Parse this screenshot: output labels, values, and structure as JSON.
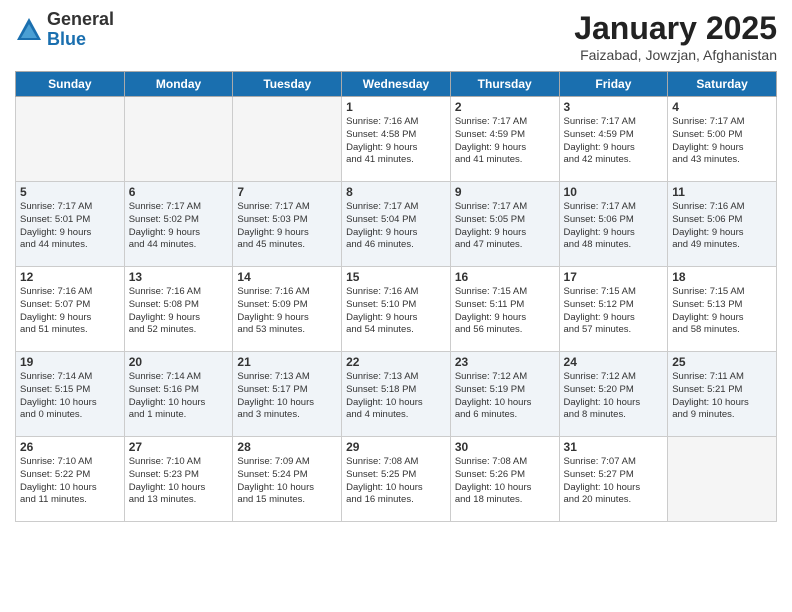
{
  "logo": {
    "general": "General",
    "blue": "Blue"
  },
  "header": {
    "title": "January 2025",
    "subtitle": "Faizabad, Jowzjan, Afghanistan"
  },
  "days_of_week": [
    "Sunday",
    "Monday",
    "Tuesday",
    "Wednesday",
    "Thursday",
    "Friday",
    "Saturday"
  ],
  "weeks": [
    [
      {
        "day": "",
        "info": ""
      },
      {
        "day": "",
        "info": ""
      },
      {
        "day": "",
        "info": ""
      },
      {
        "day": "1",
        "info": "Sunrise: 7:16 AM\nSunset: 4:58 PM\nDaylight: 9 hours\nand 41 minutes."
      },
      {
        "day": "2",
        "info": "Sunrise: 7:17 AM\nSunset: 4:59 PM\nDaylight: 9 hours\nand 41 minutes."
      },
      {
        "day": "3",
        "info": "Sunrise: 7:17 AM\nSunset: 4:59 PM\nDaylight: 9 hours\nand 42 minutes."
      },
      {
        "day": "4",
        "info": "Sunrise: 7:17 AM\nSunset: 5:00 PM\nDaylight: 9 hours\nand 43 minutes."
      }
    ],
    [
      {
        "day": "5",
        "info": "Sunrise: 7:17 AM\nSunset: 5:01 PM\nDaylight: 9 hours\nand 44 minutes."
      },
      {
        "day": "6",
        "info": "Sunrise: 7:17 AM\nSunset: 5:02 PM\nDaylight: 9 hours\nand 44 minutes."
      },
      {
        "day": "7",
        "info": "Sunrise: 7:17 AM\nSunset: 5:03 PM\nDaylight: 9 hours\nand 45 minutes."
      },
      {
        "day": "8",
        "info": "Sunrise: 7:17 AM\nSunset: 5:04 PM\nDaylight: 9 hours\nand 46 minutes."
      },
      {
        "day": "9",
        "info": "Sunrise: 7:17 AM\nSunset: 5:05 PM\nDaylight: 9 hours\nand 47 minutes."
      },
      {
        "day": "10",
        "info": "Sunrise: 7:17 AM\nSunset: 5:06 PM\nDaylight: 9 hours\nand 48 minutes."
      },
      {
        "day": "11",
        "info": "Sunrise: 7:16 AM\nSunset: 5:06 PM\nDaylight: 9 hours\nand 49 minutes."
      }
    ],
    [
      {
        "day": "12",
        "info": "Sunrise: 7:16 AM\nSunset: 5:07 PM\nDaylight: 9 hours\nand 51 minutes."
      },
      {
        "day": "13",
        "info": "Sunrise: 7:16 AM\nSunset: 5:08 PM\nDaylight: 9 hours\nand 52 minutes."
      },
      {
        "day": "14",
        "info": "Sunrise: 7:16 AM\nSunset: 5:09 PM\nDaylight: 9 hours\nand 53 minutes."
      },
      {
        "day": "15",
        "info": "Sunrise: 7:16 AM\nSunset: 5:10 PM\nDaylight: 9 hours\nand 54 minutes."
      },
      {
        "day": "16",
        "info": "Sunrise: 7:15 AM\nSunset: 5:11 PM\nDaylight: 9 hours\nand 56 minutes."
      },
      {
        "day": "17",
        "info": "Sunrise: 7:15 AM\nSunset: 5:12 PM\nDaylight: 9 hours\nand 57 minutes."
      },
      {
        "day": "18",
        "info": "Sunrise: 7:15 AM\nSunset: 5:13 PM\nDaylight: 9 hours\nand 58 minutes."
      }
    ],
    [
      {
        "day": "19",
        "info": "Sunrise: 7:14 AM\nSunset: 5:15 PM\nDaylight: 10 hours\nand 0 minutes."
      },
      {
        "day": "20",
        "info": "Sunrise: 7:14 AM\nSunset: 5:16 PM\nDaylight: 10 hours\nand 1 minute."
      },
      {
        "day": "21",
        "info": "Sunrise: 7:13 AM\nSunset: 5:17 PM\nDaylight: 10 hours\nand 3 minutes."
      },
      {
        "day": "22",
        "info": "Sunrise: 7:13 AM\nSunset: 5:18 PM\nDaylight: 10 hours\nand 4 minutes."
      },
      {
        "day": "23",
        "info": "Sunrise: 7:12 AM\nSunset: 5:19 PM\nDaylight: 10 hours\nand 6 minutes."
      },
      {
        "day": "24",
        "info": "Sunrise: 7:12 AM\nSunset: 5:20 PM\nDaylight: 10 hours\nand 8 minutes."
      },
      {
        "day": "25",
        "info": "Sunrise: 7:11 AM\nSunset: 5:21 PM\nDaylight: 10 hours\nand 9 minutes."
      }
    ],
    [
      {
        "day": "26",
        "info": "Sunrise: 7:10 AM\nSunset: 5:22 PM\nDaylight: 10 hours\nand 11 minutes."
      },
      {
        "day": "27",
        "info": "Sunrise: 7:10 AM\nSunset: 5:23 PM\nDaylight: 10 hours\nand 13 minutes."
      },
      {
        "day": "28",
        "info": "Sunrise: 7:09 AM\nSunset: 5:24 PM\nDaylight: 10 hours\nand 15 minutes."
      },
      {
        "day": "29",
        "info": "Sunrise: 7:08 AM\nSunset: 5:25 PM\nDaylight: 10 hours\nand 16 minutes."
      },
      {
        "day": "30",
        "info": "Sunrise: 7:08 AM\nSunset: 5:26 PM\nDaylight: 10 hours\nand 18 minutes."
      },
      {
        "day": "31",
        "info": "Sunrise: 7:07 AM\nSunset: 5:27 PM\nDaylight: 10 hours\nand 20 minutes."
      },
      {
        "day": "",
        "info": ""
      }
    ]
  ]
}
